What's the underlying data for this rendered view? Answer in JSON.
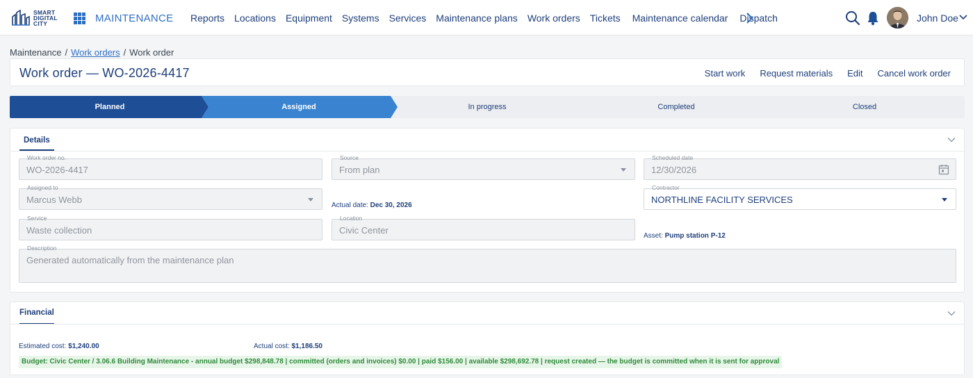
{
  "app": {
    "logo_lines": [
      "SMART",
      "DIGITAL",
      "CITY"
    ],
    "name": "MAINTENANCE"
  },
  "nav": {
    "items": [
      "Reports",
      "Locations",
      "Equipment",
      "Systems",
      "Services",
      "Maintenance plans",
      "Work orders",
      "Tickets",
      "Maintenance calendar",
      "Dispatch"
    ],
    "more_icon": "chevron-right-icon"
  },
  "user": {
    "name": "John Doe",
    "icons": [
      "search-icon",
      "bell-icon",
      "avatar",
      "chevron-down-icon"
    ]
  },
  "breadcrumb": {
    "root": "Maintenance",
    "link": "Work orders",
    "current": "Work order",
    "separator": "/"
  },
  "header": {
    "title": "Work order — WO-2026-4417",
    "actions": [
      "Start work",
      "Request materials",
      "Edit",
      "Cancel work order"
    ]
  },
  "status": {
    "steps": [
      "Planned",
      "Assigned",
      "In progress",
      "Completed",
      "Closed"
    ],
    "completed_color": "#1d4e96",
    "current_color": "#3a83d1",
    "pending_color": "#eceef1"
  },
  "details": {
    "tab": "Details",
    "work_order_no": {
      "label": "Work order no.",
      "value": "WO-2026-4417"
    },
    "source": {
      "label": "Source",
      "value": "From plan"
    },
    "scheduled_date": {
      "label": "Scheduled date",
      "value": "12/30/2026"
    },
    "assigned_to": {
      "label": "Assigned to",
      "value": "Marcus Webb"
    },
    "actual_date": {
      "label": "Actual date:",
      "value": "Dec 30, 2026"
    },
    "contractor": {
      "label": "Contractor",
      "value": "NORTHLINE FACILITY SERVICES"
    },
    "service": {
      "label": "Service",
      "value": "Waste collection"
    },
    "location": {
      "label": "Location",
      "value": "Civic Center"
    },
    "asset": {
      "label": "Asset:",
      "value": "Pump station P-12"
    },
    "description": {
      "label": "Description",
      "value": "Generated automatically from the maintenance plan"
    }
  },
  "financial": {
    "tab": "Financial",
    "estimated_cost": {
      "label": "Estimated cost:",
      "value": "$1,240.00"
    },
    "actual_cost": {
      "label": "Actual cost:",
      "value": "$1,186.50"
    },
    "budget_text": "Budget: Civic Center / 3.06.6 Building Maintenance - annual budget $298,848.78 | committed (orders and invoices) $0.00 | paid $156.00 | available $298,692.78 | request created — the budget is committed when it is sent for approval",
    "budget_color": "#2e8b3a"
  }
}
